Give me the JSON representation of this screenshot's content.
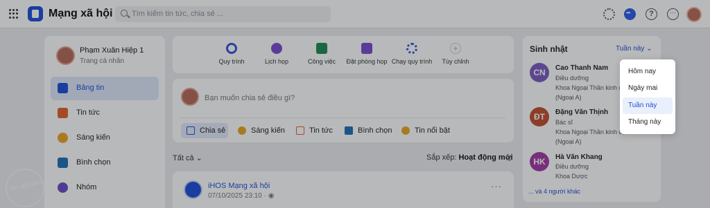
{
  "app": {
    "title": "Mạng xã hội"
  },
  "search": {
    "placeholder": "Tìm kiếm tin tức, chia sẻ ..."
  },
  "profile": {
    "name": "Phạm Xuân Hiệp 1",
    "subtitle": "Trang cá nhân"
  },
  "sidebar": {
    "items": [
      {
        "label": "Bảng tin",
        "icon": "newsfeed-icon",
        "color": "#1d4fd8",
        "active": true
      },
      {
        "label": "Tin tức",
        "icon": "news-icon",
        "color": "#e2622b",
        "active": false
      },
      {
        "label": "Sáng kiến",
        "icon": "lightbulb-icon",
        "color": "#e8a628",
        "active": false
      },
      {
        "label": "Bình chọn",
        "icon": "poll-icon",
        "color": "#1f6fb5",
        "active": false
      },
      {
        "label": "Nhóm",
        "icon": "group-icon",
        "color": "#6b4bc9",
        "active": false
      }
    ]
  },
  "quick_actions": [
    {
      "label": "Quy trình",
      "icon": "process-icon",
      "color": "#3355d6"
    },
    {
      "label": "Lịch họp",
      "icon": "meeting-icon",
      "color": "#7a4bd2"
    },
    {
      "label": "Công việc",
      "icon": "task-icon",
      "color": "#1e8a57"
    },
    {
      "label": "Đặt phòng họp",
      "icon": "room-booking-icon",
      "color": "#7a4bd2"
    },
    {
      "label": "Chạy quy trình",
      "icon": "run-process-icon",
      "color": "#3355d6"
    },
    {
      "label": "Tùy chỉnh",
      "icon": "plus-icon",
      "color": "#bbbbbb"
    }
  ],
  "composer": {
    "placeholder": "Bạn muốn chia sẻ điều gì?",
    "actions": [
      {
        "label": "Chia sẻ",
        "icon": "share-icon",
        "color": "#1d4fd8",
        "active": true
      },
      {
        "label": "Sáng kiến",
        "icon": "lightbulb-icon",
        "color": "#e8a628",
        "active": false
      },
      {
        "label": "Tin tức",
        "icon": "news-icon",
        "color": "#e2622b",
        "active": false
      },
      {
        "label": "Bình chọn",
        "icon": "poll-icon",
        "color": "#1f6fb5",
        "active": false
      },
      {
        "label": "Tin nổi bật",
        "icon": "highlight-icon",
        "color": "#e8a628",
        "active": false
      }
    ]
  },
  "feed": {
    "filter": "Tất cả",
    "sort_label": "Sắp xếp:",
    "sort_value": "Hoạt động mới",
    "post": {
      "author": "iHOS Mạng xã hội",
      "time": "07/10/2025 23:10"
    }
  },
  "birthday": {
    "title": "Sinh nhật",
    "range": "Tuần này",
    "people": [
      {
        "initials": "CN",
        "color": "#7a5cc2",
        "name": "Cao Thanh Nam",
        "role": "Điều dưỡng",
        "dept": "Khoa Ngoại Thần kinh cột",
        "dept2": "(Ngoại A)"
      },
      {
        "initials": "ĐT",
        "color": "#c0502e",
        "name": "Đặng Văn Thịnh",
        "role": "Bác sĩ",
        "dept": "Khoa Ngoại Thần kinh cột",
        "dept2": "(Ngoại A)"
      },
      {
        "initials": "HK",
        "color": "#a33aa6",
        "name": "Hà Văn Khang",
        "role": "Điều dưỡng",
        "dept": "Khoa Dược",
        "dept2": ""
      }
    ],
    "more": "... và 4 người khác"
  },
  "dropdown": {
    "options": [
      {
        "label": "Hôm nay",
        "selected": false
      },
      {
        "label": "Ngày mai",
        "selected": false
      },
      {
        "label": "Tuần này",
        "selected": true
      },
      {
        "label": "Tháng này",
        "selected": false
      }
    ]
  },
  "watermark": {
    "text": "DỮ LIỆU MẪU"
  }
}
